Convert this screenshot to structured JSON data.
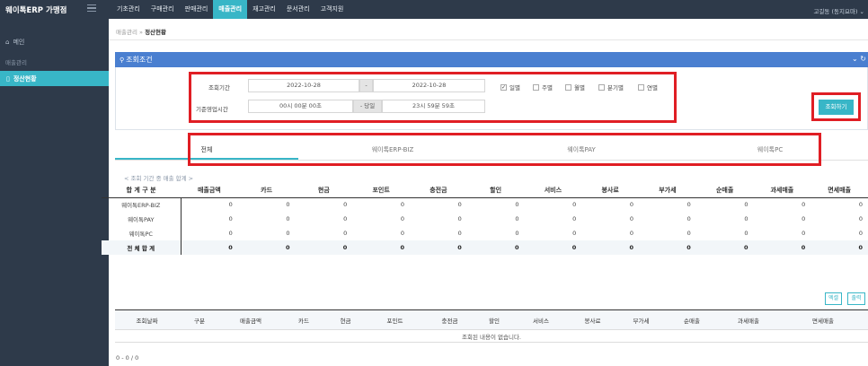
{
  "app": {
    "brand": "웨이톡ERP 가맹점",
    "user": "고길동 (동지요마)"
  },
  "menu": [
    "기초관리",
    "구매관리",
    "판매관리",
    "매출관리",
    "재고관리",
    "문서관리",
    "고객지원"
  ],
  "sidebar": {
    "main": "메인",
    "section": "매출관리",
    "active": "정산현황"
  },
  "breadcrumb": {
    "parent": "매출관리",
    "sep": "»",
    "current": "정산현황"
  },
  "search": {
    "title": "조회조건",
    "period_label": "조회기간",
    "date_from": "2022-10-28",
    "date_sep": "-",
    "date_to": "2022-10-28",
    "options": [
      {
        "label": "일별",
        "checked": true
      },
      {
        "label": "주별",
        "checked": false
      },
      {
        "label": "월별",
        "checked": false
      },
      {
        "label": "분기별",
        "checked": false
      },
      {
        "label": "연별",
        "checked": false
      }
    ],
    "hours_label": "기준영업시간",
    "time_from": "00시 00분 00초",
    "time_sep": "- 당일",
    "time_to": "23시 59분 59초",
    "button": "조회하기",
    "collapse_icon": "chevron-down-icon",
    "refresh_icon": "refresh-icon"
  },
  "tabs": [
    "전체",
    "웨이톡ERP-BIZ",
    "웨이톡PAY",
    "웨이톡PC"
  ],
  "summary": {
    "title": "< 조회 기간 중 매출 합계 >",
    "headers": [
      "합 계 구 분",
      "매출금액",
      "카드",
      "현금",
      "포인트",
      "충전금",
      "할인",
      "서비스",
      "봉사료",
      "부가세",
      "순매출",
      "과세매출",
      "면세매출"
    ],
    "rows": [
      [
        "웨이톡ERP-BIZ",
        "0",
        "0",
        "0",
        "0",
        "0",
        "0",
        "0",
        "0",
        "0",
        "0",
        "0",
        "0"
      ],
      [
        "웨이톡PAY",
        "0",
        "0",
        "0",
        "0",
        "0",
        "0",
        "0",
        "0",
        "0",
        "0",
        "0",
        "0"
      ],
      [
        "웨이톡PC",
        "0",
        "0",
        "0",
        "0",
        "0",
        "0",
        "0",
        "0",
        "0",
        "0",
        "0",
        "0"
      ],
      [
        "전 체 합 계",
        "0",
        "0",
        "0",
        "0",
        "0",
        "0",
        "0",
        "0",
        "0",
        "0",
        "0",
        "0"
      ]
    ]
  },
  "actions": {
    "excel": "엑셀",
    "print": "출력"
  },
  "detail": {
    "headers": [
      "조회날짜",
      "구분",
      "매출금액",
      "카드",
      "현금",
      "포인트",
      "충전금",
      "할인",
      "서비스",
      "봉사료",
      "부가세",
      "순매출",
      "과세매출",
      "면세매출"
    ],
    "empty": "조회된 내용이 없습니다."
  },
  "pager": "0 - 0 / 0",
  "colors": {
    "topbar": "#2e3a4a",
    "accent": "#38b6c7",
    "panel_header": "#4a7fd0",
    "highlight": "#e01e24"
  }
}
